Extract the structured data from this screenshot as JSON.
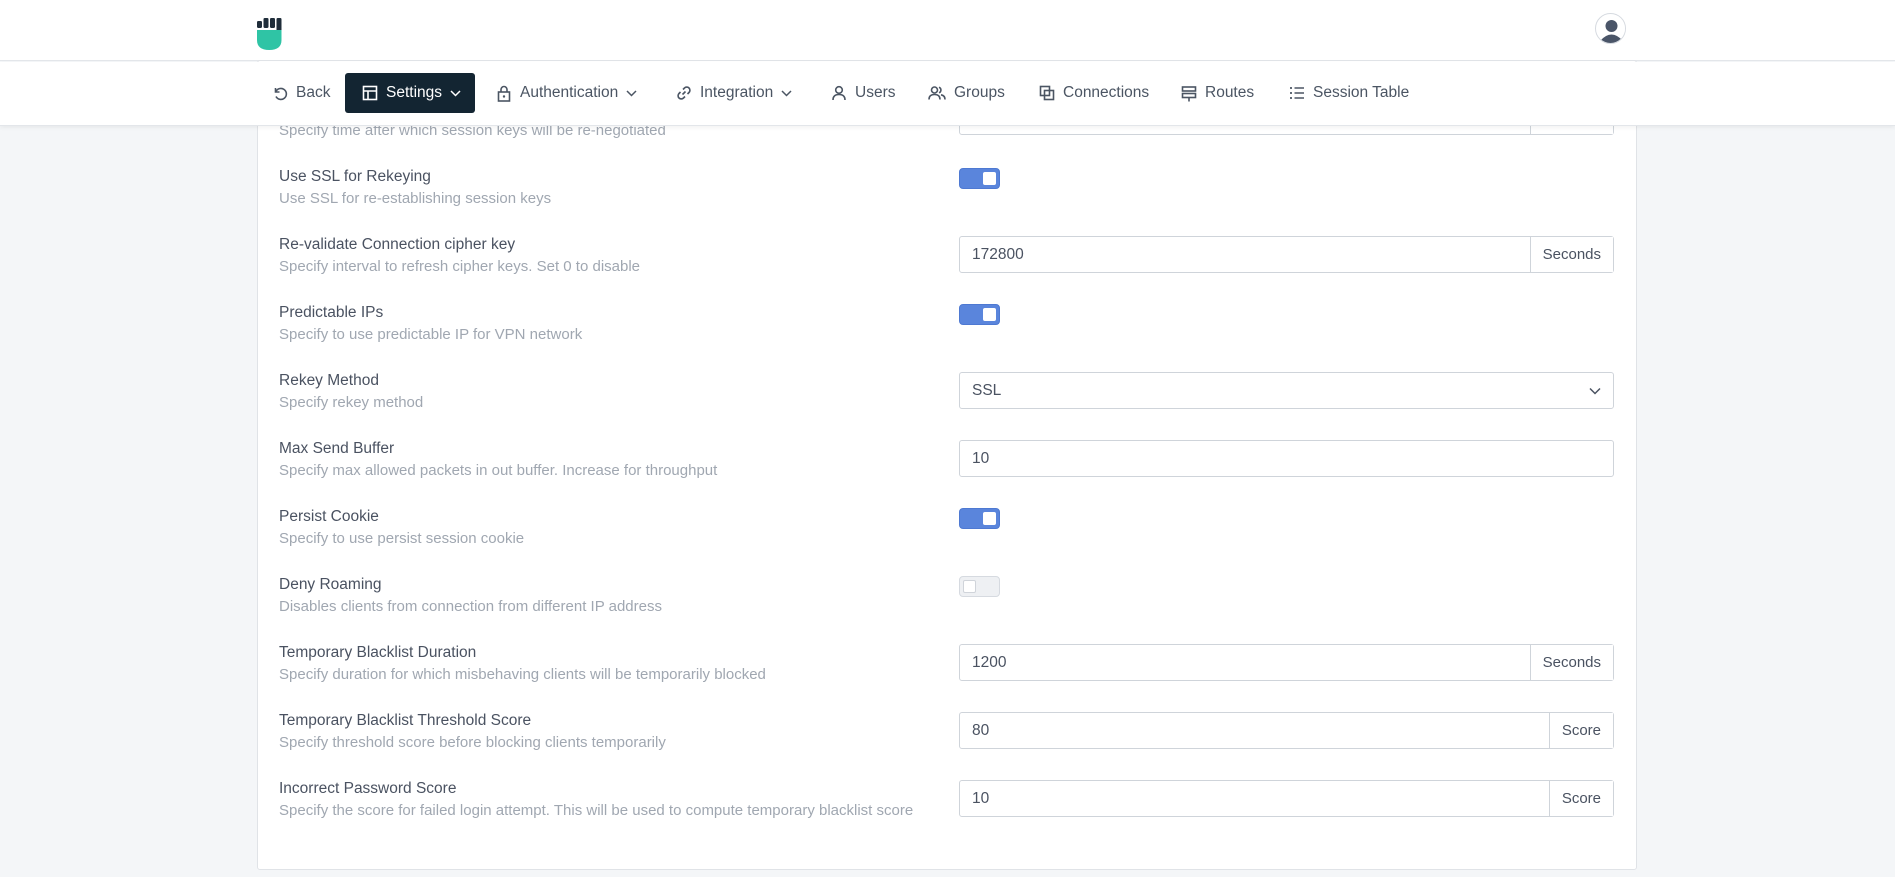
{
  "nav": {
    "back": "Back",
    "settings": "Settings",
    "authentication": "Authentication",
    "integration": "Integration",
    "users": "Users",
    "groups": "Groups",
    "connections": "Connections",
    "routes": "Routes",
    "session_table": "Session Table"
  },
  "colors": {
    "nav_active_bg": "#132532",
    "toggle_on": "#5a85dc",
    "logo_teal": "#2fc4a5",
    "logo_dark": "#1f2d3a"
  },
  "settings": {
    "partial_top": {
      "desc": "Specify time after which session keys will be re-negotiated"
    },
    "ssl_rekeying": {
      "label": "Use SSL for Rekeying",
      "desc": "Use SSL for re-establishing session keys",
      "enabled": true
    },
    "revalidate_cipher": {
      "label": "Re-validate Connection cipher key",
      "desc": "Specify interval to refresh cipher keys. Set 0 to disable",
      "value": "172800",
      "unit": "Seconds"
    },
    "predictable_ips": {
      "label": "Predictable IPs",
      "desc": "Specify to use predictable IP for VPN network",
      "enabled": true
    },
    "rekey_method": {
      "label": "Rekey Method",
      "desc": "Specify rekey method",
      "value": "SSL"
    },
    "max_send_buffer": {
      "label": "Max Send Buffer",
      "desc": "Specify max allowed packets in out buffer. Increase for throughput",
      "value": "10"
    },
    "persist_cookie": {
      "label": "Persist Cookie",
      "desc": "Specify to use persist session cookie",
      "enabled": true
    },
    "deny_roaming": {
      "label": "Deny Roaming",
      "desc": "Disables clients from connection from different IP address",
      "enabled": false
    },
    "blacklist_duration": {
      "label": "Temporary Blacklist Duration",
      "desc": "Specify duration for which misbehaving clients will be temporarily blocked",
      "value": "1200",
      "unit": "Seconds"
    },
    "blacklist_threshold": {
      "label": "Temporary Blacklist Threshold Score",
      "desc": "Specify threshold score before blocking clients temporarily",
      "value": "80",
      "unit": "Score"
    },
    "incorrect_password": {
      "label": "Incorrect Password Score",
      "desc": "Specify the score for failed login attempt. This will be used to compute temporary blacklist score",
      "value": "10",
      "unit": "Score"
    }
  }
}
